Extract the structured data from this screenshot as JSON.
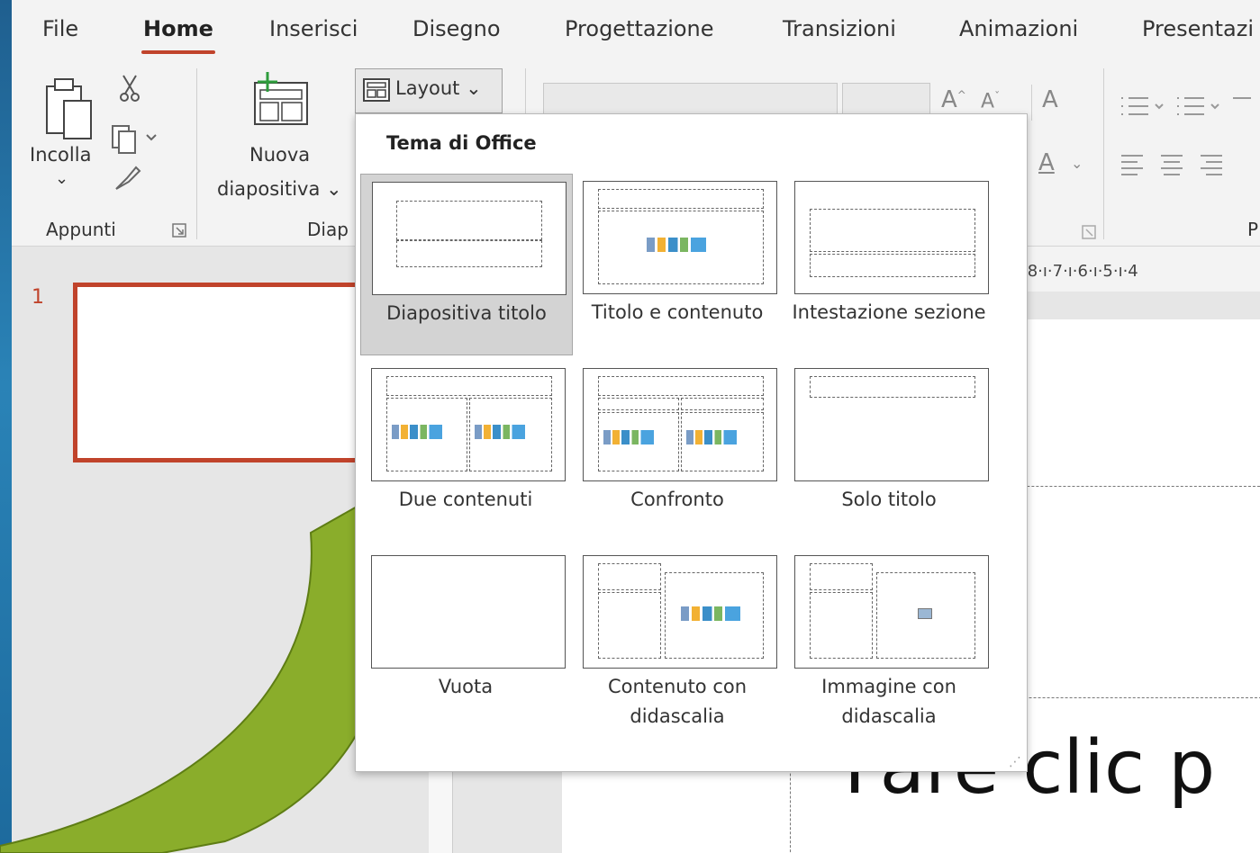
{
  "tabs": [
    "File",
    "Home",
    "Inserisci",
    "Disegno",
    "Progettazione",
    "Transizioni",
    "Animazioni",
    "Presentazi"
  ],
  "ribbon": {
    "paste_label": "Incolla",
    "paste_arrow": "⌄",
    "clipboard_group": "Appunti",
    "new_slide_line1": "Nuova",
    "new_slide_line2": "diapositiva ⌄",
    "slides_group": "Diap",
    "layout_button": "Layout ⌄",
    "paragraph_group_partial": "P"
  },
  "slide_number": "1",
  "ruler_text": "·8·ı·7·ı·6·ı·5·ı·4",
  "slide_text": "Fare clic p",
  "layout_menu": {
    "title": "Tema di Office",
    "items": [
      {
        "label": "Diapositiva titolo",
        "selected": true
      },
      {
        "label": "Titolo e contenuto"
      },
      {
        "label": "Intestazione sezione"
      },
      {
        "label": "Due contenuti"
      },
      {
        "label": "Confronto"
      },
      {
        "label": "Solo titolo"
      },
      {
        "label": "Vuota"
      },
      {
        "label": "Contenuto con didascalia"
      },
      {
        "label": "Immagine con didascalia"
      }
    ]
  },
  "colors": {
    "accent": "#c0432b",
    "decor_green": "#8aad2b",
    "background_blue": "#2a83b7"
  }
}
